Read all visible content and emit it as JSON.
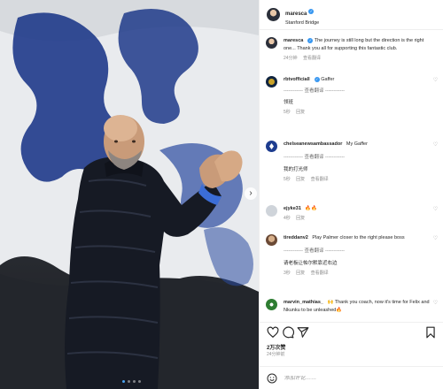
{
  "post": {
    "author": "maresca",
    "location": "Stanford Bridge",
    "caption_author": "maresca",
    "caption": "The journey is still long but the direction is the right one... Thank you all for supporting this fantastic club.",
    "caption_time": "24分钟",
    "caption_translate": "查看翻译",
    "more_label": "···"
  },
  "comments": [
    {
      "username": "rbtvofficiall",
      "text": "Gaffer",
      "translation_divider": "------------ 查看翻译 ------------",
      "translation": "领班",
      "time": "5秒",
      "reply": "回复",
      "translate_link": ""
    },
    {
      "username": "chelseanewsambassador",
      "text": "My Gaffer",
      "translation_divider": "------------ 查看翻译 ------------",
      "translation": "我的打光师",
      "time": "5秒",
      "reply": "回复",
      "translate_link": "查看翻译"
    },
    {
      "username": "ejyke31",
      "text": "🔥🔥",
      "time": "4秒",
      "reply": "回复"
    },
    {
      "username": "tireddanv2",
      "text": "Play Palmer closer to the right please boss",
      "translation_divider": "------------ 查看翻译 ------------",
      "translation": "请老板让帕尔默靠近右边",
      "time": "3秒",
      "reply": "回复",
      "translate_link": "查看翻译"
    },
    {
      "username": "marvin_mathias_",
      "text": "🙌 Thank you coach, now it's time for Felix and Nkunku to be unleashed🔥",
      "time": "",
      "reply": ""
    }
  ],
  "stats": {
    "likes": "2万次赞",
    "time": "24分钟前"
  },
  "comment_input": {
    "placeholder": "添加评论……"
  },
  "colors": {
    "accent": "#3897f0",
    "chelsea_blue": "#1d3c8f",
    "muted": "#8e8e8e"
  },
  "icons": [
    "heart-icon",
    "comment-icon",
    "share-icon",
    "bookmark-icon",
    "emoji-icon",
    "verified-icon",
    "more-icon",
    "next-image-icon"
  ]
}
